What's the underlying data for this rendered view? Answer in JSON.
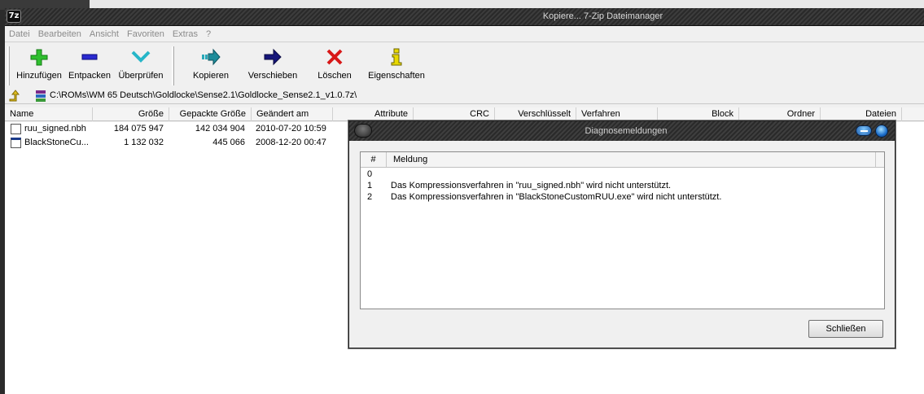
{
  "window": {
    "title": "Kopiere... 7-Zip Dateimanager",
    "app_icon_text": "7z"
  },
  "menu": [
    "Datei",
    "Bearbeiten",
    "Ansicht",
    "Favoriten",
    "Extras",
    "?"
  ],
  "toolbar": {
    "add": "Hinzufügen",
    "extract": "Entpacken",
    "test": "Überprüfen",
    "copy": "Kopieren",
    "move": "Verschieben",
    "delete": "Löschen",
    "properties": "Eigenschaften"
  },
  "address": {
    "path": "C:\\ROMs\\WM 65 Deutsch\\Goldlocke\\Sense2.1\\Goldlocke_Sense2.1_v1.0.7z\\"
  },
  "columns": [
    "Name",
    "Größe",
    "Gepackte Größe",
    "Geändert am",
    "Attribute",
    "CRC",
    "Verschlüsselt",
    "Verfahren",
    "Block",
    "Ordner",
    "Dateien"
  ],
  "files": [
    {
      "name": "ruu_signed.nbh",
      "size": "184 075 947",
      "packed": "142 034 904",
      "modified": "2010-07-20 10:59"
    },
    {
      "name": "BlackStoneCu...",
      "size": "1 132 032",
      "packed": "445 066",
      "modified": "2008-12-20 00:47"
    }
  ],
  "dialog": {
    "title": "Diagnosemeldungen",
    "col_num": "#",
    "col_msg": "Meldung",
    "messages": [
      {
        "n": "0",
        "text": ""
      },
      {
        "n": "1",
        "text": "Das Kompressionsverfahren in \"ruu_signed.nbh\" wird nicht unterstützt."
      },
      {
        "n": "2",
        "text": "Das Kompressionsverfahren in \"BlackStoneCustomRUU.exe\" wird nicht unterstützt."
      }
    ],
    "close_label": "Schließen"
  },
  "colors": {
    "titlebar_dark": "#2a2a2a",
    "menu_disabled": "#8a8a8a",
    "window_bg": "#f0f0f0"
  }
}
